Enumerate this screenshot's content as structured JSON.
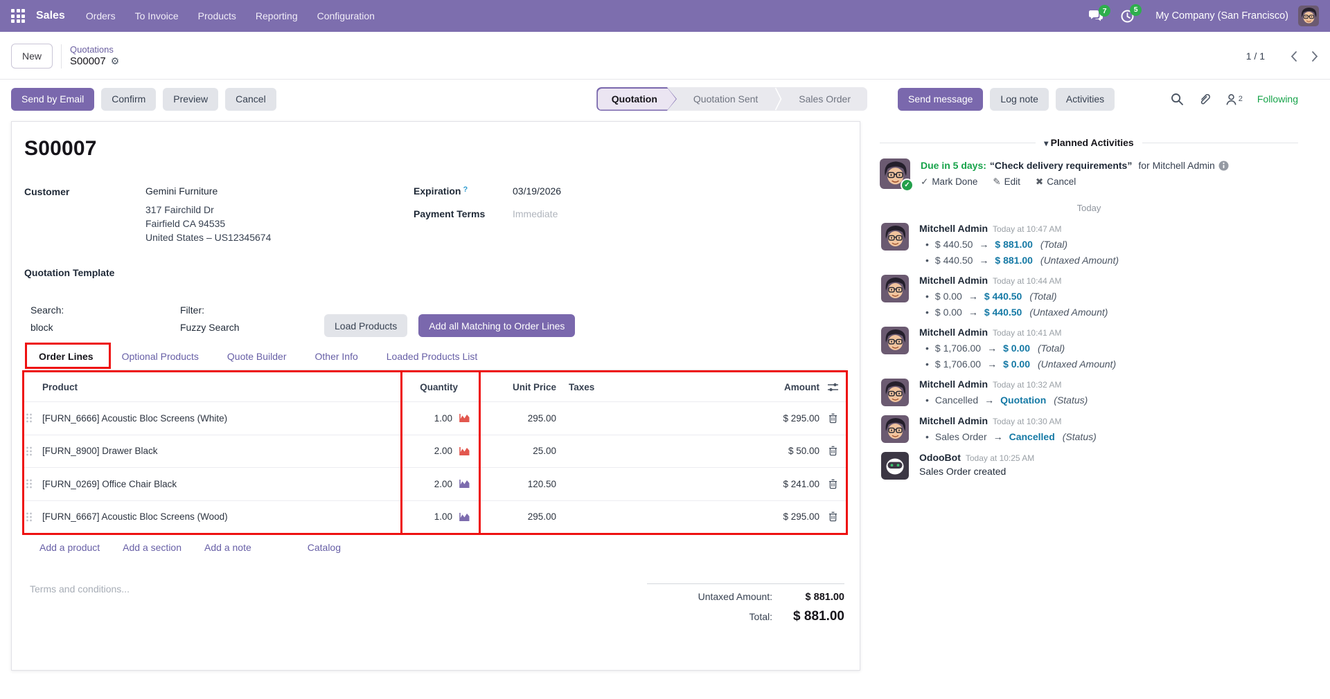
{
  "colors": {
    "nav_background": "#7d6eae",
    "accent_purple": "#7a68ad",
    "success_green": "#17a34a",
    "badge_green": "#2eae4d",
    "annotation_red": "#ee1111",
    "tracking_new_value": "#1579a5",
    "forecast_icon_red": "#e2574e",
    "forecast_icon_purple": "#7d6cae"
  },
  "nav": {
    "app_name": "Sales",
    "items": [
      "Orders",
      "To Invoice",
      "Products",
      "Reporting",
      "Configuration"
    ],
    "messages_badge": "7",
    "activities_badge": "5",
    "company": "My Company (San Francisco)"
  },
  "control_panel": {
    "new_button": "New",
    "breadcrumb_parent": "Quotations",
    "breadcrumb_current": "S00007",
    "pager": "1 / 1"
  },
  "actions": {
    "send_by_email": "Send by Email",
    "confirm": "Confirm",
    "preview": "Preview",
    "cancel": "Cancel"
  },
  "statusbar": {
    "steps": [
      "Quotation",
      "Quotation Sent",
      "Sales Order"
    ],
    "active": "Quotation"
  },
  "chatter_bar": {
    "send_message": "Send message",
    "log_note": "Log note",
    "activities": "Activities",
    "followers_count": "2",
    "following": "Following"
  },
  "form": {
    "title": "S00007",
    "customer_label": "Customer",
    "customer_name": "Gemini Furniture",
    "customer_address": [
      "317 Fairchild Dr",
      "Fairfield CA 94535",
      "United States – US12345674"
    ],
    "expiration_label": "Expiration",
    "expiration_value": "03/19/2026",
    "payment_terms_label": "Payment Terms",
    "payment_terms_placeholder": "Immediate",
    "quotation_template_label": "Quotation Template",
    "search_label": "Search:",
    "search_value": "block",
    "filter_label": "Filter:",
    "filter_value": "Fuzzy Search",
    "load_products": "Load Products",
    "add_all_matching": "Add all Matching to Order Lines"
  },
  "tabs": [
    "Order Lines",
    "Optional Products",
    "Quote Builder",
    "Other Info",
    "Loaded Products List"
  ],
  "order_table": {
    "columns": {
      "product": "Product",
      "quantity": "Quantity",
      "unit_price": "Unit Price",
      "taxes": "Taxes",
      "amount": "Amount"
    },
    "rows": [
      {
        "product": "[FURN_6666] Acoustic Bloc Screens (White)",
        "quantity": "1.00",
        "unit_price": "295.00",
        "taxes": "",
        "amount": "$ 295.00",
        "forecast_color": "red"
      },
      {
        "product": "[FURN_8900] Drawer Black",
        "quantity": "2.00",
        "unit_price": "25.00",
        "taxes": "",
        "amount": "$ 50.00",
        "forecast_color": "red"
      },
      {
        "product": "[FURN_0269] Office Chair Black",
        "quantity": "2.00",
        "unit_price": "120.50",
        "taxes": "",
        "amount": "$ 241.00",
        "forecast_color": "purple"
      },
      {
        "product": "[FURN_6667] Acoustic Bloc Screens (Wood)",
        "quantity": "1.00",
        "unit_price": "295.00",
        "taxes": "",
        "amount": "$ 295.00",
        "forecast_color": "purple"
      }
    ],
    "footer_links": [
      "Add a product",
      "Add a section",
      "Add a note",
      "Catalog"
    ],
    "terms_placeholder": "Terms and conditions...",
    "totals": {
      "untaxed_label": "Untaxed Amount:",
      "untaxed_value": "$ 881.00",
      "total_label": "Total:",
      "total_value": "$ 881.00"
    }
  },
  "chatter": {
    "planned_activities_title": "Planned Activities",
    "activity": {
      "due": "Due in 5 days:",
      "summary": "“Check delivery requirements”",
      "assignee": "for Mitchell Admin",
      "mark_done": "Mark Done",
      "edit": "Edit",
      "cancel": "Cancel"
    },
    "today_divider": "Today",
    "messages": [
      {
        "author": "Mitchell Admin",
        "time": "Today at 10:47 AM",
        "lines": [
          {
            "old": "$ 440.50",
            "new": "$ 881.00",
            "field": "(Total)"
          },
          {
            "old": "$ 440.50",
            "new": "$ 881.00",
            "field": "(Untaxed Amount)"
          }
        ]
      },
      {
        "author": "Mitchell Admin",
        "time": "Today at 10:44 AM",
        "lines": [
          {
            "old": "$ 0.00",
            "new": "$ 440.50",
            "field": "(Total)"
          },
          {
            "old": "$ 0.00",
            "new": "$ 440.50",
            "field": "(Untaxed Amount)"
          }
        ]
      },
      {
        "author": "Mitchell Admin",
        "time": "Today at 10:41 AM",
        "lines": [
          {
            "old": "$ 1,706.00",
            "new": "$ 0.00",
            "field": "(Total)"
          },
          {
            "old": "$ 1,706.00",
            "new": "$ 0.00",
            "field": "(Untaxed Amount)"
          }
        ]
      },
      {
        "author": "Mitchell Admin",
        "time": "Today at 10:32 AM",
        "lines": [
          {
            "old": "Cancelled",
            "new": "Quotation",
            "field": "(Status)"
          }
        ]
      },
      {
        "author": "Mitchell Admin",
        "time": "Today at 10:30 AM",
        "lines": [
          {
            "old": "Sales Order",
            "new": "Cancelled",
            "field": "(Status)"
          }
        ]
      },
      {
        "author": "OdooBot",
        "time": "Today at 10:25 AM",
        "body": "Sales Order created"
      }
    ]
  }
}
